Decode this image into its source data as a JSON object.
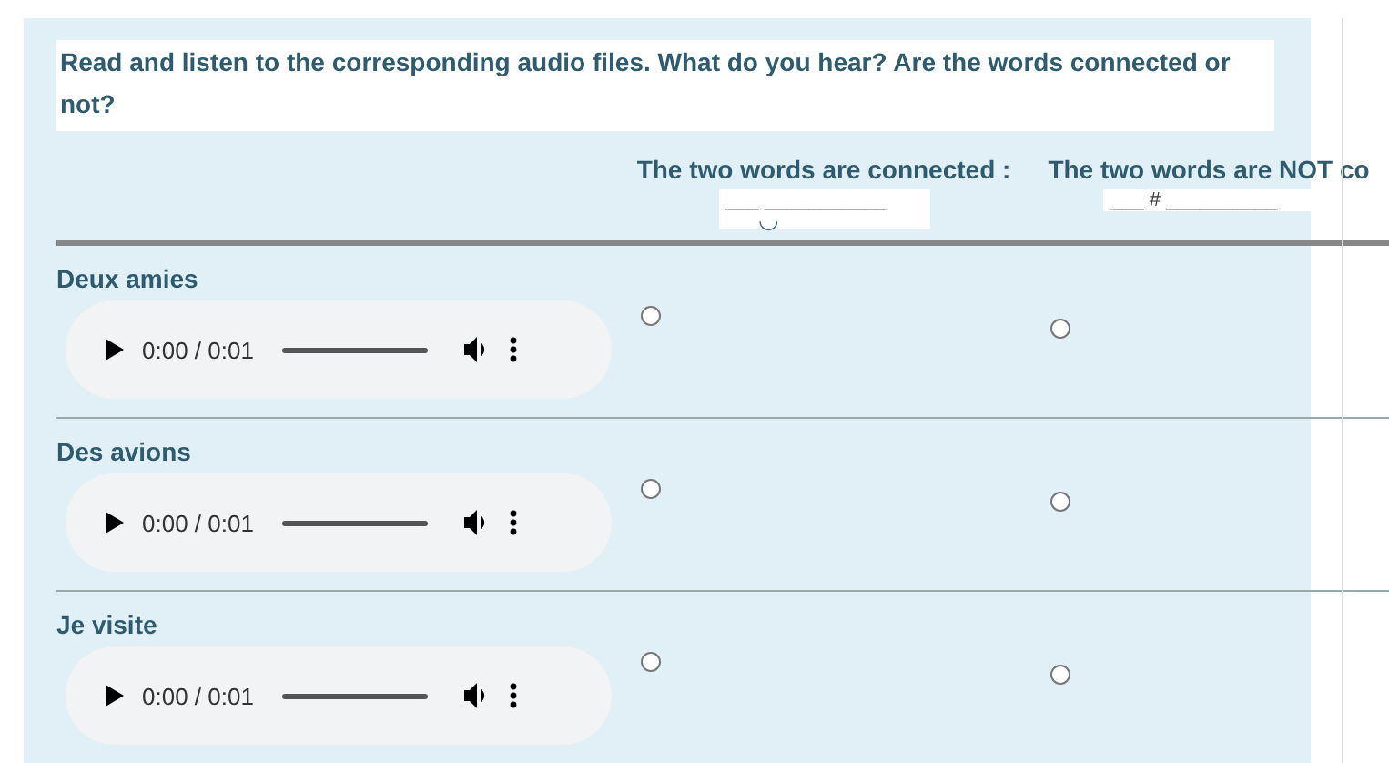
{
  "instruction": "Read and listen to the corresponding audio files. What do you hear? Are the words connected or not?",
  "columns": [
    {
      "heading": "The two words are connected :",
      "blank": "___ ___________",
      "mark": "◡"
    },
    {
      "heading": "The two words are NOT co",
      "blank": "___ # __________"
    }
  ],
  "rows": [
    {
      "label": "Deux amies",
      "time": "0:00 / 0:01",
      "choices": [
        {
          "selected": false
        },
        {
          "selected": false
        }
      ]
    },
    {
      "label": "Des avions",
      "time": "0:00 / 0:01",
      "choices": [
        {
          "selected": false
        },
        {
          "selected": false
        }
      ]
    },
    {
      "label": "Je visite",
      "time": "0:00 / 0:01",
      "choices": [
        {
          "selected": false
        },
        {
          "selected": false
        }
      ]
    }
  ]
}
